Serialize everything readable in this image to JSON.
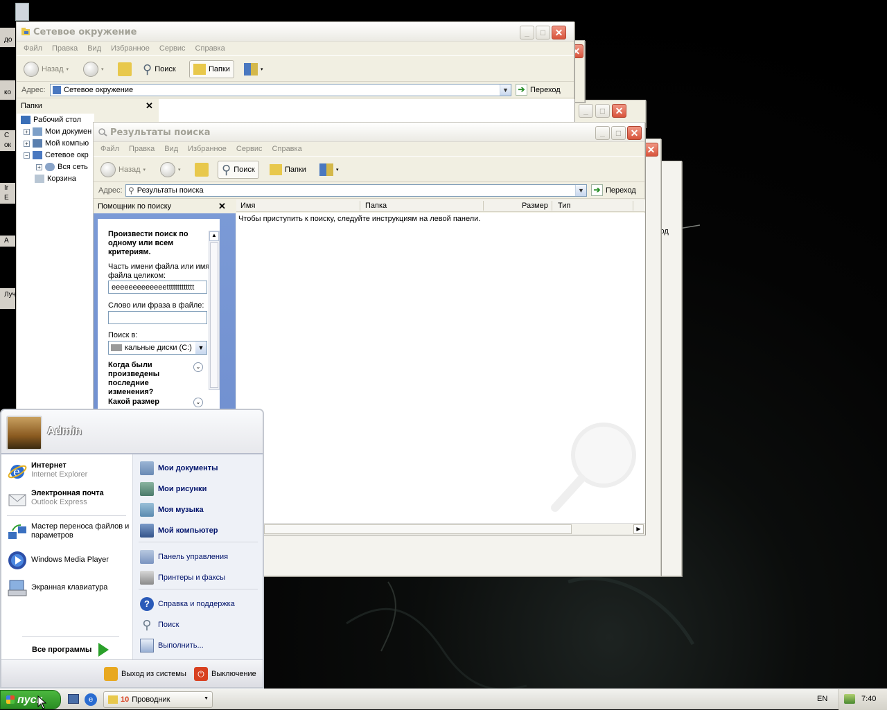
{
  "colors": {
    "accent": "#2a8d23",
    "menu_link": "#00136b",
    "title_inactive": "#a2a196"
  },
  "desktop": {
    "icon_labels": [
      "до",
      "ко",
      "С",
      "ок",
      "Ir",
      "E",
      "А",
      "Луч"
    ]
  },
  "network_window": {
    "title": "Сетевое окружение",
    "menu": [
      "Файл",
      "Правка",
      "Вид",
      "Избранное",
      "Сервис",
      "Справка"
    ],
    "toolbar": {
      "back": "Назад",
      "search": "Поиск",
      "folders": "Папки"
    },
    "address_label": "Адрес:",
    "address_value": "Сетевое окружение",
    "go_label": "Переход",
    "folders_pane_title": "Папки",
    "tree": [
      "Рабочий стол",
      "Мои докумен",
      "Мой компью",
      "Сетевое окр",
      "Вся сеть",
      "Корзина"
    ]
  },
  "search_window": {
    "title": "Результаты поиска",
    "menu": [
      "Файл",
      "Правка",
      "Вид",
      "Избранное",
      "Сервис",
      "Справка"
    ],
    "toolbar": {
      "back": "Назад",
      "search": "Поиск",
      "folders": "Папки"
    },
    "address_label": "Адрес:",
    "address_value": "Результаты поиска",
    "go_label": "Переход",
    "assistant_title": "Помощник по поиску",
    "criteria_heading": "Произвести поиск по одному или всем критериям.",
    "filename_label": "Часть имени файла или имя файла целиком:",
    "filename_value": "eeeeeeeeeeeeettttttttttttt",
    "phrase_label": "Слово или фраза в файле:",
    "phrase_value": "",
    "lookin_label": "Поиск в:",
    "lookin_value": "кальные диски (C:)",
    "when_modified": "Когда были произведены последние изменения?",
    "size_label": "Какой размер",
    "columns": [
      "Имя",
      "Папка",
      "Размер",
      "Тип"
    ],
    "empty_message": "Чтобы приступить к поиску, следуйте инструкциям на левой панели."
  },
  "back_window": {
    "go_label": "ереход"
  },
  "start_menu": {
    "user": "Admin",
    "pinned": [
      {
        "title": "Интернет",
        "subtitle": "Internet Explorer"
      },
      {
        "title": "Электронная почта",
        "subtitle": "Outlook Express"
      }
    ],
    "recent": [
      "Мастер переноса файлов и параметров",
      "Windows Media Player",
      "Экранная клавиатура"
    ],
    "all_programs": "Все программы",
    "right_bold": [
      "Мои документы",
      "Мои рисунки",
      "Моя музыка",
      "Мой компьютер"
    ],
    "right_mid": [
      "Панель управления",
      "Принтеры и факсы"
    ],
    "right_bottom": [
      "Справка и поддержка",
      "Поиск",
      "Выполнить..."
    ],
    "logoff": "Выход из системы",
    "shutdown": "Выключение"
  },
  "taskbar": {
    "start_label": "пуск",
    "task_count": "10",
    "task_label": "Проводник",
    "language": "EN",
    "clock": "7:40"
  }
}
